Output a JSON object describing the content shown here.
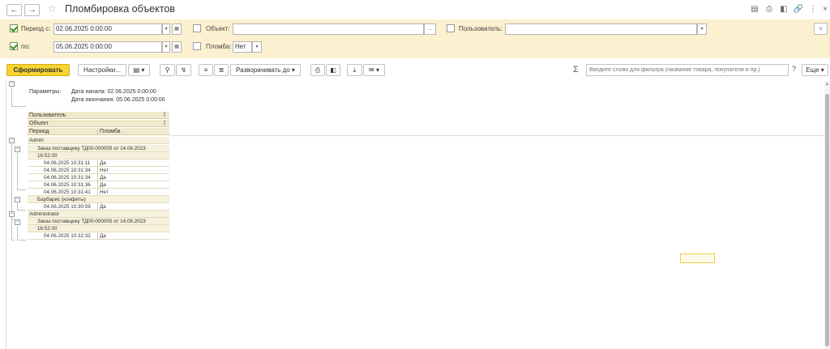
{
  "window": {
    "title": "Пломбировка объектов"
  },
  "filters": {
    "period_from_label": "Период с:",
    "period_from_value": "02.06.2025  0:00:00",
    "period_from_checked": true,
    "period_to_label": "по:",
    "period_to_value": "05.06.2025  0:00:00",
    "period_to_checked": true,
    "object_label": "Объект:",
    "object_value": "",
    "object_checked": false,
    "seal_label": "Пломба:",
    "seal_value": "Нет",
    "seal_checked": false,
    "user_label": "Пользователь:",
    "user_value": "",
    "user_checked": false
  },
  "toolbar": {
    "generate_label": "Сформировать",
    "settings_label": "Настройки...",
    "expand_label": "Разворачивать до",
    "search_placeholder": "Введите слово для фильтра (название товара, покупателя и пр.)",
    "help_label": "?",
    "more_label": "Еще"
  },
  "report": {
    "params_label": "Параметры:",
    "start_date": "Дата начала: 02.06.2025 0:00:00",
    "end_date": "Дата окончания: 05.06.2025 0:00:00",
    "headers": {
      "user": "Пользователь",
      "object": "Объект",
      "period": "Период",
      "seal": "Пломба"
    },
    "groups": [
      {
        "user": "Admin",
        "objects": [
          {
            "name_line1": "Заказ поставщику ТД00-000005 от 14.08.2023",
            "name_line2": "16:52:00",
            "rows": [
              {
                "period": "04.06.2025 10:31:11",
                "seal": "Да"
              },
              {
                "period": "04.06.2025 10:31:34",
                "seal": "Нет"
              },
              {
                "period": "04.06.2025 10:31:34",
                "seal": "Да"
              },
              {
                "period": "04.06.2025 10:31:36",
                "seal": "Да"
              },
              {
                "period": "04.06.2025 10:31:41",
                "seal": "Нет"
              }
            ]
          },
          {
            "name_line1": "Барбарис (конфеты)",
            "rows": [
              {
                "period": "04.06.2025 10:30:59",
                "seal": "Да"
              }
            ]
          }
        ]
      },
      {
        "user": "Administrator",
        "objects": [
          {
            "name_line1": "Заказ поставщику ТД00-000005 от 14.08.2023",
            "name_line2": "16:52:00",
            "rows": [
              {
                "period": "04.06.2025 10:32:32",
                "seal": "Да"
              }
            ]
          }
        ]
      }
    ]
  },
  "colors": {
    "filter_bg": "#fbf0cf",
    "accent_button": "#f7d431",
    "header_bg": "#f0e9cd",
    "selected_cell_border": "#f2c94c"
  }
}
